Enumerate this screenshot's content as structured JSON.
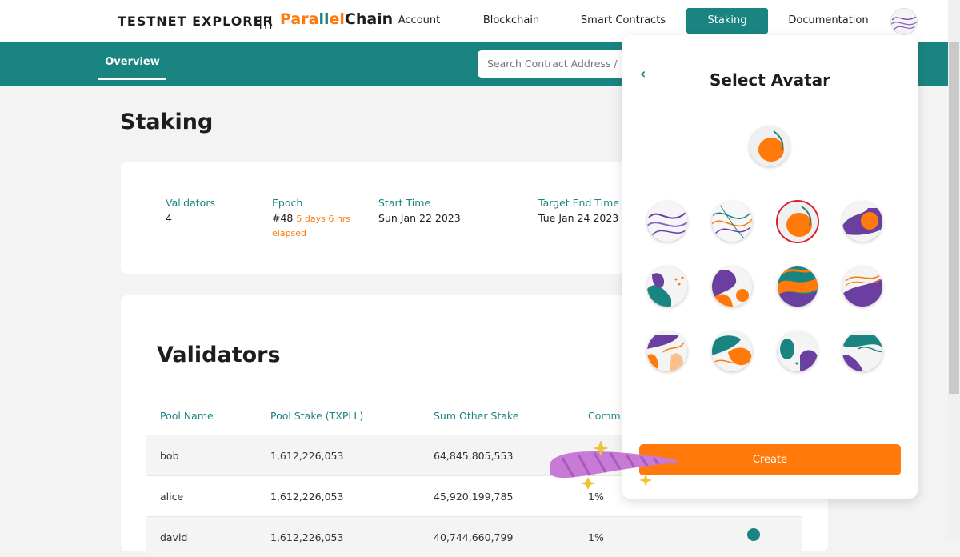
{
  "header": {
    "brand": "TESTNET EXPLORER",
    "separator": "|||",
    "logo_parts": [
      "Para",
      "ll",
      "el",
      "Chain"
    ],
    "nav": [
      "Account",
      "Blockchain",
      "Smart Contracts",
      "Staking",
      "Documentation"
    ],
    "active_nav": "Staking"
  },
  "subnav": {
    "tab": "Overview",
    "search_placeholder": "Search Contract Address /"
  },
  "page": {
    "title": "Staking"
  },
  "stats": {
    "validators_label": "Validators",
    "validators_value": "4",
    "epoch_label": "Epoch",
    "epoch_value": "#48",
    "epoch_elapsed": "5 days 6 hrs",
    "epoch_elapsed_2": "elapsed",
    "start_label": "Start Time",
    "start_value": "Sun Jan 22 2023",
    "target_label": "Target End Time",
    "target_value": "Tue Jan 24 2023"
  },
  "validators": {
    "title": "Validators",
    "columns": [
      "Pool Name",
      "Pool Stake (TXPLL)",
      "Sum Other Stake",
      "Comm"
    ],
    "rows": [
      {
        "name": "bob",
        "stake": "1,612,226,053",
        "other": "64,845,805,553",
        "comm": ""
      },
      {
        "name": "alice",
        "stake": "1,612,226,053",
        "other": "45,920,199,785",
        "comm": "1%"
      },
      {
        "name": "david",
        "stake": "1,612,226,053",
        "other": "40,744,660,799",
        "comm": "1%"
      }
    ]
  },
  "modal": {
    "back_icon": "chevron-left-icon",
    "title": "Select Avatar",
    "create_label": "Create",
    "selected_index": 2
  },
  "colors": {
    "teal": "#1a8481",
    "orange": "#ff7a0a",
    "purple": "#6a3fa0",
    "selected_ring": "#d8212a"
  }
}
